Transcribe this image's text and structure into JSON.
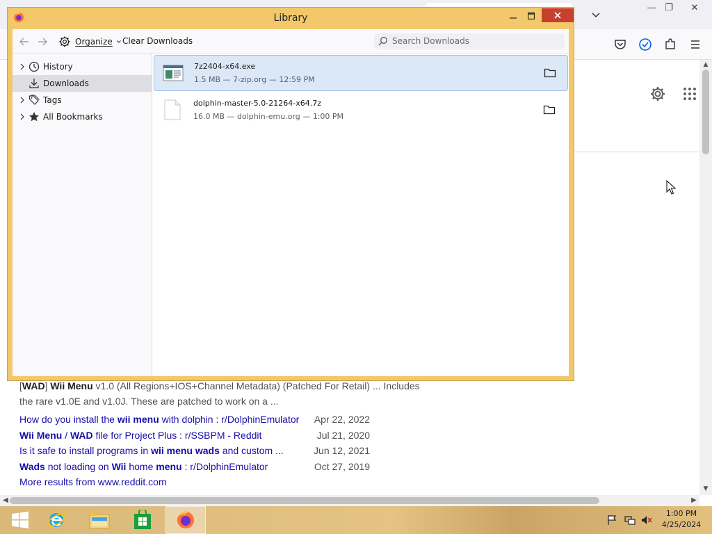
{
  "browser": {
    "window_controls": {
      "minimize": "—",
      "restore": "❐",
      "close": "✕"
    }
  },
  "search_results": {
    "snippet_line1_parts": [
      "[",
      "WAD",
      "] ",
      "Wii Menu",
      " v1.0 (All Regions+IOS+Channel Metadata) (Patched For Retail) ... Includes"
    ],
    "snippet_line2": "the rare v1.0E and v1.0J. These are patched to work on a ...",
    "rows": [
      {
        "link_parts": [
          "How do you install the ",
          "wii menu",
          " with dolphin : r/DolphinEmulator"
        ],
        "date": "Apr 22, 2022"
      },
      {
        "link_parts": [
          "Wii Menu",
          " / ",
          "WAD",
          " file for Project Plus : r/SSBPM - Reddit"
        ],
        "date": "Jul 21, 2020"
      },
      {
        "link_parts": [
          "Is it safe to install programs in ",
          "wii menu wads",
          " and custom ..."
        ],
        "date": "Jun 12, 2021"
      },
      {
        "link_parts": [
          "Wads",
          " not loading on ",
          "Wii",
          " home ",
          "menu",
          " : r/DolphinEmulator"
        ],
        "date": "Oct 27, 2019"
      }
    ],
    "more_results": "More results from www.reddit.com"
  },
  "library": {
    "title": "Library",
    "toolbar": {
      "organize_label": "Organize",
      "clear_downloads_label": "Clear Downloads",
      "search_placeholder": "Search Downloads"
    },
    "sidebar": [
      {
        "label": "History",
        "icon": "clock-icon",
        "expandable": true
      },
      {
        "label": "Downloads",
        "icon": "download-icon",
        "expandable": false,
        "selected": true
      },
      {
        "label": "Tags",
        "icon": "tags-icon",
        "expandable": true
      },
      {
        "label": "All Bookmarks",
        "icon": "star-icon",
        "expandable": true
      }
    ],
    "downloads": [
      {
        "name": "7z2404-x64.exe",
        "meta": "1.5 MB — 7-zip.org — 12:59 PM",
        "icon": "exe-file-icon",
        "selected": true
      },
      {
        "name": "dolphin-master-5.0-21264-x64.7z",
        "meta": "16.0 MB — dolphin-emu.org — 1:00 PM",
        "icon": "generic-file-icon",
        "selected": false
      }
    ]
  },
  "taskbar": {
    "clock_time": "1:00 PM",
    "clock_date": "4/25/2024"
  }
}
